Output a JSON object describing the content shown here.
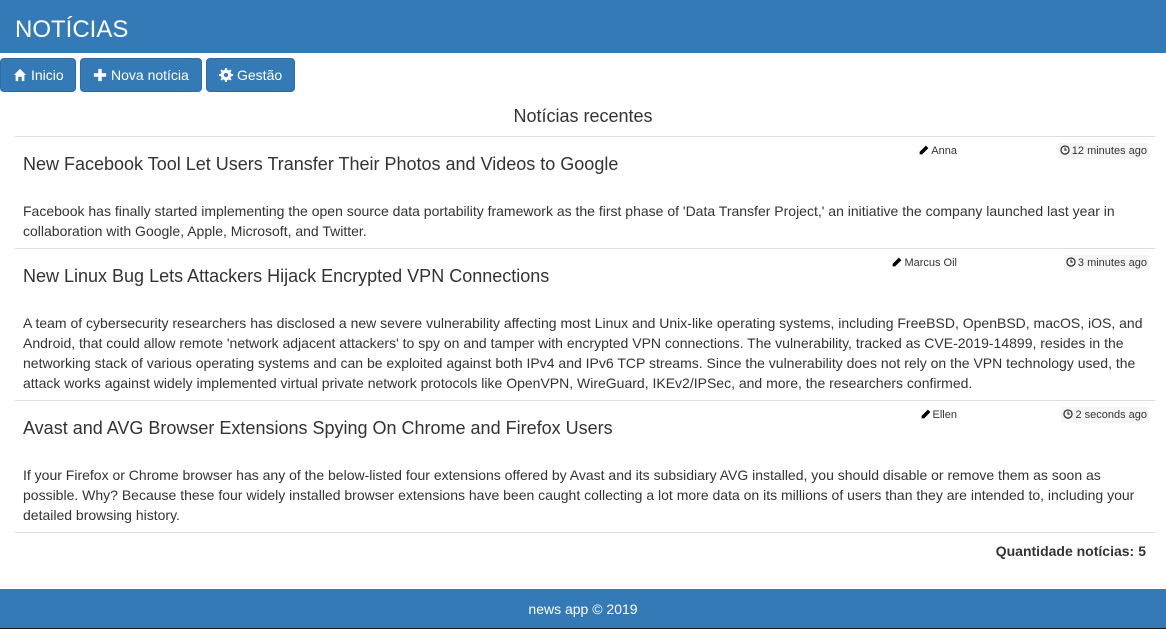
{
  "header": {
    "brand": "NOTÍCIAS"
  },
  "nav": {
    "home": {
      "label": "Inicio",
      "icon": "home-icon"
    },
    "new_news": {
      "label": "Nova notícia",
      "icon": "plus-icon"
    },
    "manage": {
      "label": "Gestão",
      "icon": "gear-icon"
    }
  },
  "main": {
    "section_title": "Notícias recentes",
    "news": [
      {
        "title": "New Facebook Tool Let Users Transfer Their Photos and Videos to Google",
        "author": "Anna",
        "time": "12 minutes ago",
        "body": "Facebook has finally started implementing the open source data portability framework as the first phase of 'Data Transfer Project,' an initiative the company launched last year in collaboration with Google, Apple, Microsoft, and Twitter."
      },
      {
        "title": "New Linux Bug Lets Attackers Hijack Encrypted VPN Connections",
        "author": "Marcus Oil",
        "time": "3 minutes ago",
        "body": "A team of cybersecurity researchers has disclosed a new severe vulnerability affecting most Linux and Unix-like operating systems, including FreeBSD, OpenBSD, macOS, iOS, and Android, that could allow remote 'network adjacent attackers' to spy on and tamper with encrypted VPN connections. The vulnerability, tracked as CVE-2019-14899, resides in the networking stack of various operating systems and can be exploited against both IPv4 and IPv6 TCP streams. Since the vulnerability does not rely on the VPN technology used, the attack works against widely implemented virtual private network protocols like OpenVPN, WireGuard, IKEv2/IPSec, and more, the researchers confirmed."
      },
      {
        "title": "Avast and AVG Browser Extensions Spying On Chrome and Firefox Users",
        "author": "Ellen",
        "time": "2 seconds ago",
        "body": "If your Firefox or Chrome browser has any of the below-listed four extensions offered by Avast and its subsidiary AVG installed, you should disable or remove them as soon as possible. Why? Because these four widely installed browser extensions have been caught collecting a lot more data on its millions of users than they are intended to, including your detailed browsing history."
      }
    ],
    "count_label": "Quantidade notícias:",
    "count_value": "5"
  },
  "footer": {
    "copyright": "news app © 2019"
  },
  "colors": {
    "primary": "#337ab7",
    "primary_border": "#2e6da4",
    "divider": "#dddddd"
  }
}
